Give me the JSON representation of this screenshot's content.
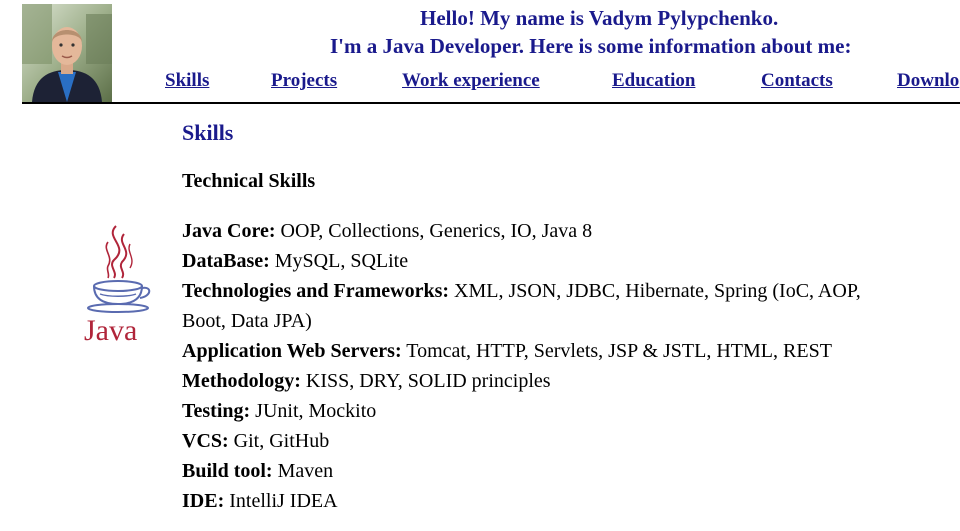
{
  "header": {
    "greeting_line1": "Hello! My name is Vadym Pylypchenko.",
    "greeting_line2": "I'm a Java Developer. Here is some information about me:"
  },
  "nav": {
    "items": [
      {
        "label": "Skills"
      },
      {
        "label": "Projects"
      },
      {
        "label": "Work experience"
      },
      {
        "label": "Education"
      },
      {
        "label": "Contacts"
      },
      {
        "label": "Downlo"
      }
    ]
  },
  "section": {
    "title": "Skills",
    "subtitle": "Technical Skills"
  },
  "java_logo": {
    "text": "Java"
  },
  "skills": [
    {
      "label": "Java Core:",
      "value": " OOP, Collections, Generics, IO, Java 8"
    },
    {
      "label": "DataBase:",
      "value": " MySQL, SQLite"
    },
    {
      "label": "Technologies and Frameworks:",
      "value": " XML, JSON, JDBC, Hibernate, Spring (IoC, AOP,"
    },
    {
      "label": "",
      "value": "Boot, Data JPA)"
    },
    {
      "label": "Application Web Servers:",
      "value": " Tomcat, HTTP, Servlets, JSP & JSTL, HTML, REST"
    },
    {
      "label": "Methodology:",
      "value": " KISS, DRY, SOLID principles"
    },
    {
      "label": "Testing:",
      "value": " JUnit, Mockito"
    },
    {
      "label": "VCS:",
      "value": " Git, GitHub"
    },
    {
      "label": "Build tool:",
      "value": " Maven"
    },
    {
      "label": "IDE:",
      "value": " IntelliJ IDEA"
    }
  ],
  "colors": {
    "link": "#1a1a8c",
    "java_red": "#b0253a",
    "java_blue": "#5a6bb0"
  }
}
